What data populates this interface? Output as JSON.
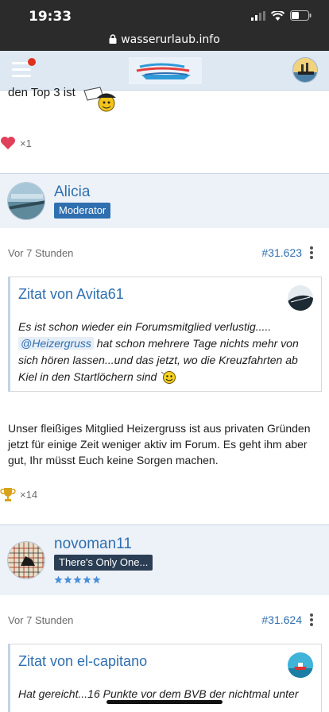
{
  "status": {
    "time": "19:33",
    "url": "wasserurlaub.info"
  },
  "prev_post": {
    "text_fragment": "den Top 3 ist",
    "reaction_count": "×1"
  },
  "posts": [
    {
      "author": "Alicia",
      "role": "Moderator",
      "time": "Vor 7 Stunden",
      "number": "#31.623",
      "quote": {
        "title": "Zitat von Avita61",
        "text_1": "Es ist schon wieder ein Forumsmitglied verlustig.....",
        "mention": "@Heizergruss",
        "text_2": "hat schon mehrere Tage nichts mehr von sich hören lassen...und das jetzt, wo die Kreuzfahrten ab Kiel in den Startlöchern sind"
      },
      "body": "Unser fleißiges Mitglied Heizergruss ist aus privaten Gründen jetzt für einige Zeit weniger aktiv im Forum. Es geht ihm aber gut, Ihr müsst Euch keine Sorgen machen.",
      "reaction_count": "×14"
    },
    {
      "author": "novoman11",
      "role": "There's Only One...",
      "time": "Vor 7 Stunden",
      "number": "#31.624",
      "quote": {
        "title": "Zitat von el-capitano",
        "text_1": "Hat gereicht...16 Punkte vor dem BVB der nichtmal unter"
      }
    }
  ],
  "colors": {
    "accent": "#2f6fb0",
    "moderator_badge": "#2f6fb0",
    "rank_badge": "#2b3e54",
    "heart": "#e0405a",
    "trophy": "#d9a21b"
  }
}
